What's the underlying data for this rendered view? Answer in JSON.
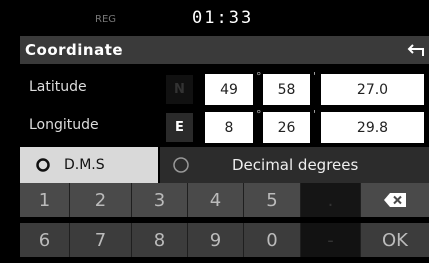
{
  "status_bar": {
    "indicator": "REG",
    "time": "01:33"
  },
  "header": {
    "title": "Coordinate",
    "back_icon": "back-arrow-icon"
  },
  "latitude": {
    "label": "Latitude",
    "direction": "N",
    "degrees": "49",
    "minutes": "58",
    "seconds": "27.0"
  },
  "longitude": {
    "label": "Longitude",
    "direction": "E",
    "degrees": "8",
    "minutes": "26",
    "seconds": "29.8"
  },
  "units": {
    "degree_mark": "°",
    "minute_mark": "'"
  },
  "mode": {
    "dms_label": "D.M.S",
    "decimal_label": "Decimal degrees",
    "selected": "D.M.S"
  },
  "keypad": {
    "row1": [
      "1",
      "2",
      "3",
      "4",
      "5",
      "."
    ],
    "row2": [
      "6",
      "7",
      "8",
      "9",
      "0",
      "-"
    ],
    "ok_label": "OK",
    "backspace_icon": "backspace-icon"
  }
}
